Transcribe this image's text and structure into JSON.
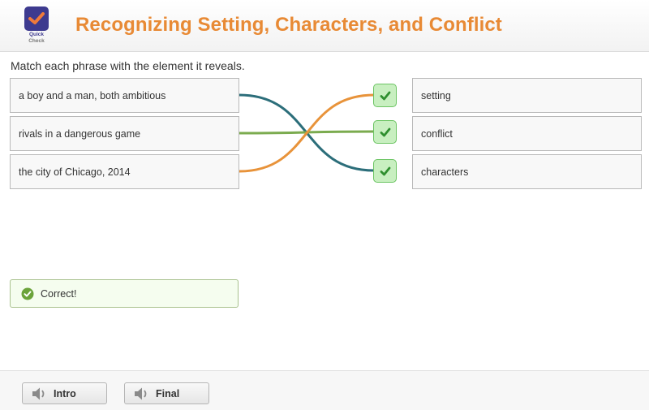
{
  "header": {
    "logo": {
      "icon": "checkmark-icon",
      "line1": "Quick",
      "line2": "Check"
    },
    "title": "Recognizing Setting, Characters, and Conflict"
  },
  "instructions": "Match each phrase with the element it reveals.",
  "phrases": [
    {
      "label": "a boy and a man, both ambitious"
    },
    {
      "label": "rivals in a dangerous game"
    },
    {
      "label": "the city of Chicago, 2014"
    }
  ],
  "elements": [
    {
      "label": "setting",
      "status": "correct"
    },
    {
      "label": "conflict",
      "status": "correct"
    },
    {
      "label": "characters",
      "status": "correct"
    }
  ],
  "connections": [
    {
      "from": 0,
      "to": 2,
      "color": "#2c6e7a"
    },
    {
      "from": 1,
      "to": 1,
      "color": "#7bab4f"
    },
    {
      "from": 2,
      "to": 0,
      "color": "#e8933a"
    }
  ],
  "feedback": {
    "icon": "check-circle-icon",
    "text": "Correct!",
    "color": "#6ba33a"
  },
  "footer": {
    "buttons": [
      {
        "label": "Intro",
        "icon": "speaker-icon"
      },
      {
        "label": "Final",
        "icon": "speaker-icon"
      }
    ]
  }
}
